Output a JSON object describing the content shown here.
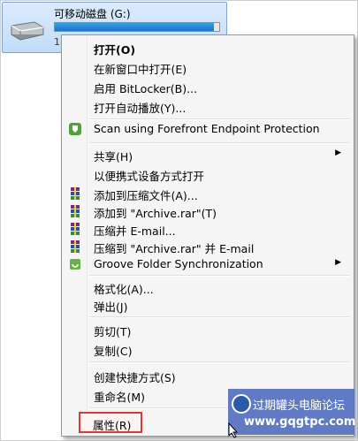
{
  "drive": {
    "name": "可移动磁盘 (G:)",
    "free_text": "1.",
    "usage_fraction": 0.97,
    "icon": "usb-drive-icon"
  },
  "menu": {
    "items": [
      {
        "label": "打开(O)",
        "bold": true,
        "icon": "",
        "submenu": false
      },
      {
        "label": "在新窗口中打开(E)",
        "icon": "",
        "submenu": false
      },
      {
        "label": "启用 BitLocker(B)...",
        "icon": "",
        "submenu": false
      },
      {
        "label": "打开自动播放(Y)...",
        "icon": "",
        "submenu": false
      },
      {
        "label": "Scan using Forefront Endpoint Protection",
        "icon": "forefront-shield-icon",
        "submenu": false
      },
      {
        "label": "共享(H)",
        "icon": "",
        "submenu": true
      },
      {
        "label": "以便携式设备方式打开",
        "icon": "",
        "submenu": false
      },
      {
        "label": "添加到压缩文件(A)...",
        "icon": "winrar-icon",
        "submenu": false
      },
      {
        "label": "添加到 \"Archive.rar\"(T)",
        "icon": "winrar-icon",
        "submenu": false
      },
      {
        "label": "压缩并 E-mail...",
        "icon": "winrar-icon",
        "submenu": false
      },
      {
        "label": "压缩到 \"Archive.rar\" 并 E-mail",
        "icon": "winrar-icon",
        "submenu": false
      },
      {
        "label": "Groove Folder Synchronization",
        "icon": "groove-icon",
        "submenu": true
      },
      {
        "label": "格式化(A)...",
        "icon": "",
        "submenu": false
      },
      {
        "label": "弹出(J)",
        "icon": "",
        "submenu": false
      },
      {
        "label": "剪切(T)",
        "icon": "",
        "submenu": false
      },
      {
        "label": "复制(C)",
        "icon": "",
        "submenu": false
      },
      {
        "label": "创建快捷方式(S)",
        "icon": "",
        "submenu": false
      },
      {
        "label": "重命名(M)",
        "icon": "",
        "submenu": false
      },
      {
        "label": "属性(R)",
        "icon": "",
        "submenu": false,
        "highlighted": true
      }
    ],
    "submenu_arrow": "▶"
  },
  "watermark": {
    "title": "过期罐头电脑论坛",
    "url": "www.gqgtpc.com"
  },
  "colors": {
    "highlight_border": "#d83a3a",
    "selection_bg": "#c1dcf7",
    "progress_fill": "#1c72c8"
  }
}
